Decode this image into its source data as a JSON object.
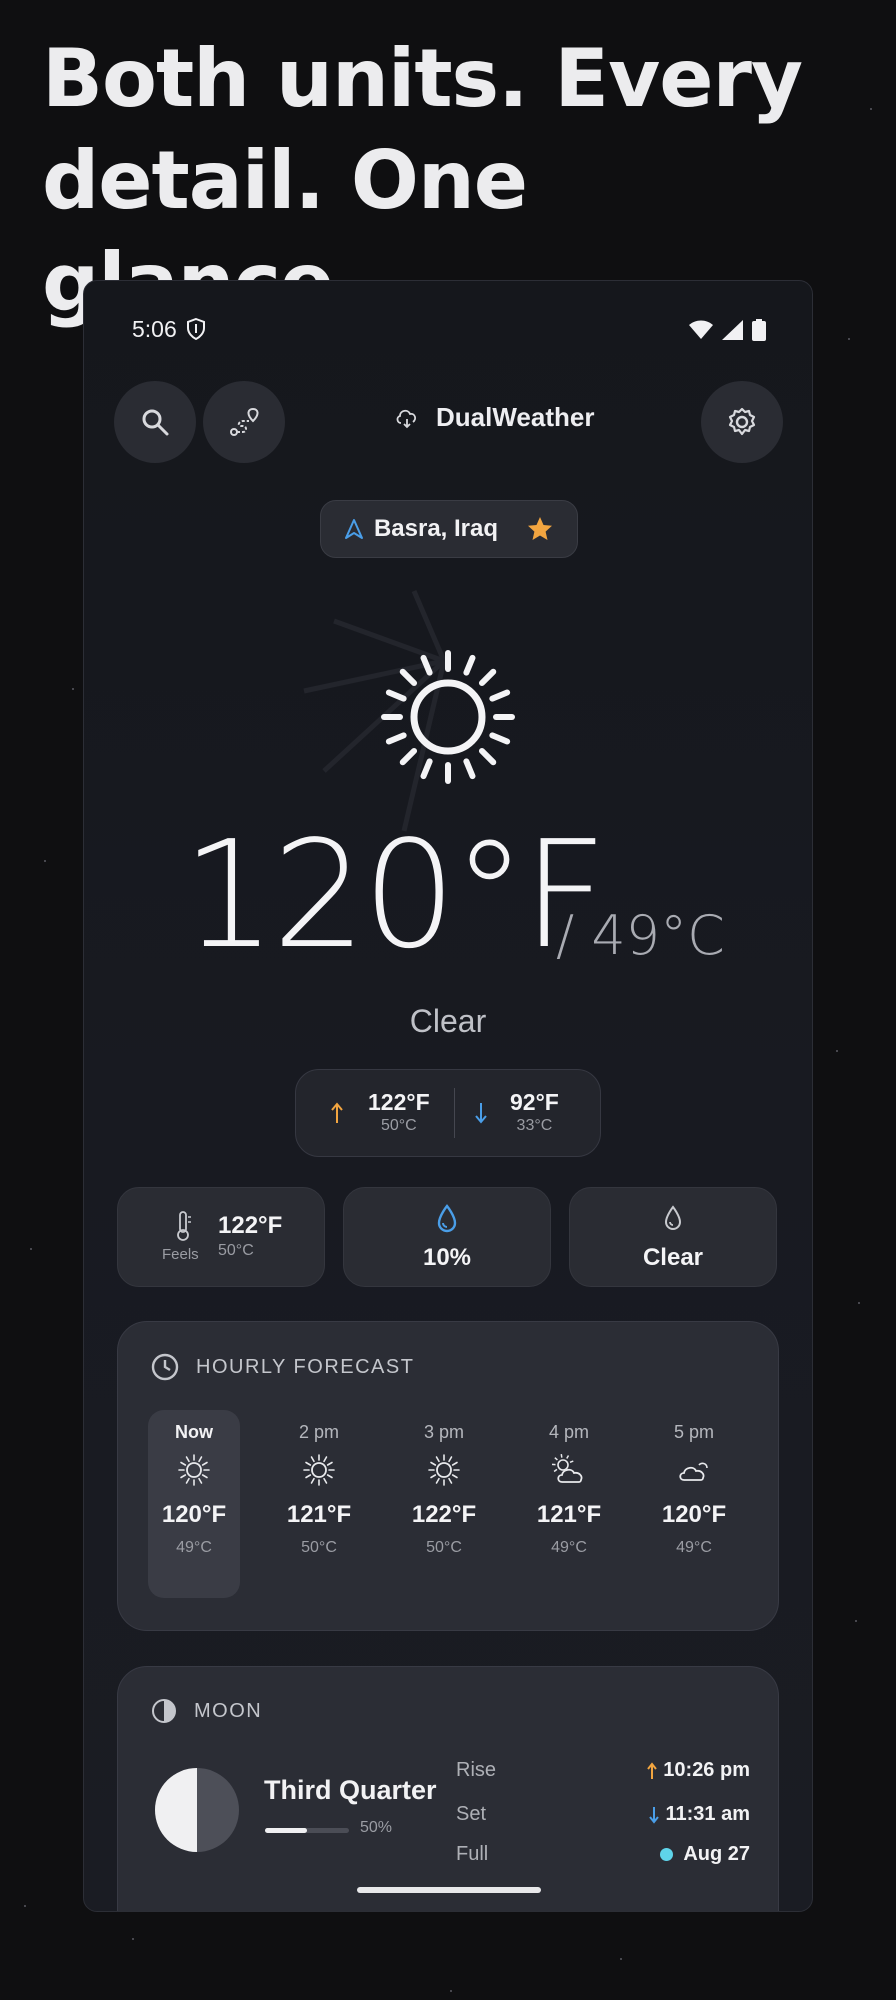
{
  "headline": "Both units. Every detail. One glance.",
  "status_bar": {
    "time": "5:06"
  },
  "app": {
    "name": "DualWeather"
  },
  "location": {
    "name": "Basra, Iraq"
  },
  "current": {
    "temp_f": "120°F",
    "temp_c": "/ 49°C",
    "condition": "Clear",
    "high_f": "122°F",
    "high_c": "50°C",
    "low_f": "92°F",
    "low_c": "33°C"
  },
  "stats": {
    "feels_label": "Feels",
    "feels_f": "122°F",
    "feels_c": "50°C",
    "precip": "10%",
    "cloud": "Clear"
  },
  "hourly": {
    "title": "HOURLY FORECAST",
    "items": [
      {
        "time": "Now",
        "icon": "sun-icon",
        "f": "120°F",
        "c": "49°C"
      },
      {
        "time": "2 pm",
        "icon": "sun-icon",
        "f": "121°F",
        "c": "50°C"
      },
      {
        "time": "3 pm",
        "icon": "sun-icon",
        "f": "122°F",
        "c": "50°C"
      },
      {
        "time": "4 pm",
        "icon": "partly-cloudy-icon",
        "f": "121°F",
        "c": "49°C"
      },
      {
        "time": "5 pm",
        "icon": "cloud-icon",
        "f": "120°F",
        "c": "49°C"
      }
    ]
  },
  "moon": {
    "title": "MOON",
    "phase": "Third Quarter",
    "illumination_pct": "50%",
    "illumination_fraction": 0.5,
    "rise_label": "Rise",
    "rise": "10:26 pm",
    "set_label": "Set",
    "set": "11:31 am",
    "full_label": "Full",
    "full": "Aug 27"
  },
  "colors": {
    "background": "#0f0f11",
    "card": "#2a2c33",
    "accent_orange": "#f2a540",
    "accent_blue": "#4a9ee8",
    "full_moon_dot": "#5fd4ea"
  }
}
